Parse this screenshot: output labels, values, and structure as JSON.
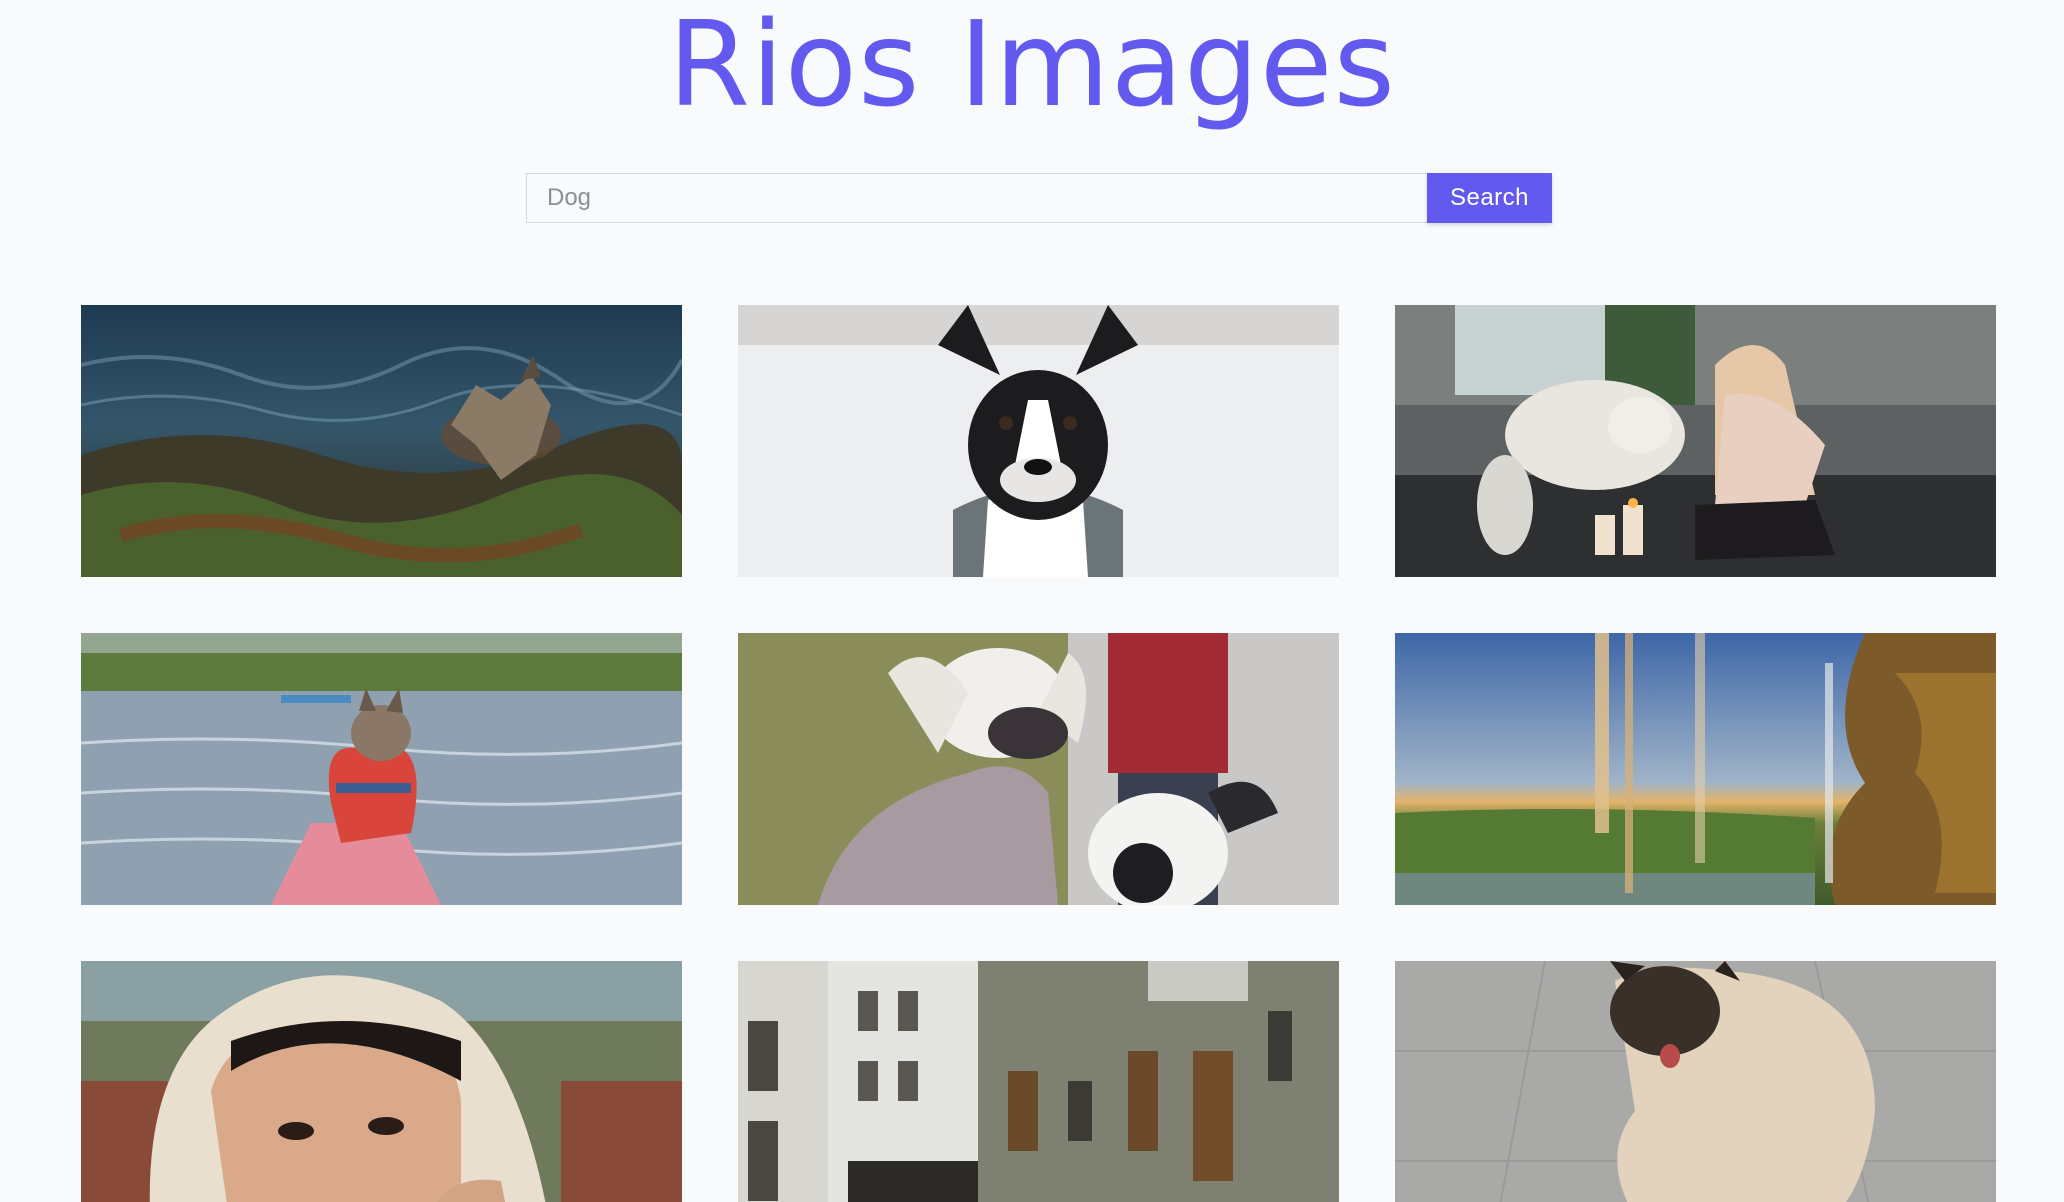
{
  "header": {
    "title": "Rios Images"
  },
  "search": {
    "value": "",
    "placeholder": "Dog",
    "button_label": "Search"
  },
  "colors": {
    "accent": "#6259ee",
    "background": "#f8fafc"
  },
  "gallery": {
    "images": [
      {
        "subject": "dog-on-rocky-shore-photo"
      },
      {
        "subject": "boston-terrier-in-snow-photo"
      },
      {
        "subject": "woman-with-white-dog-on-sofa-photo"
      },
      {
        "subject": "french-bulldog-in-life-vest-on-kayak-photo"
      },
      {
        "subject": "chinese-crested-dogs-photo"
      },
      {
        "subject": "waterfall-cave-landscape-photo"
      },
      {
        "subject": "person-in-bucket-hat-photo"
      },
      {
        "subject": "apartment-buildings-courtyard-photo"
      },
      {
        "subject": "pug-on-tile-floor-photo"
      }
    ]
  }
}
